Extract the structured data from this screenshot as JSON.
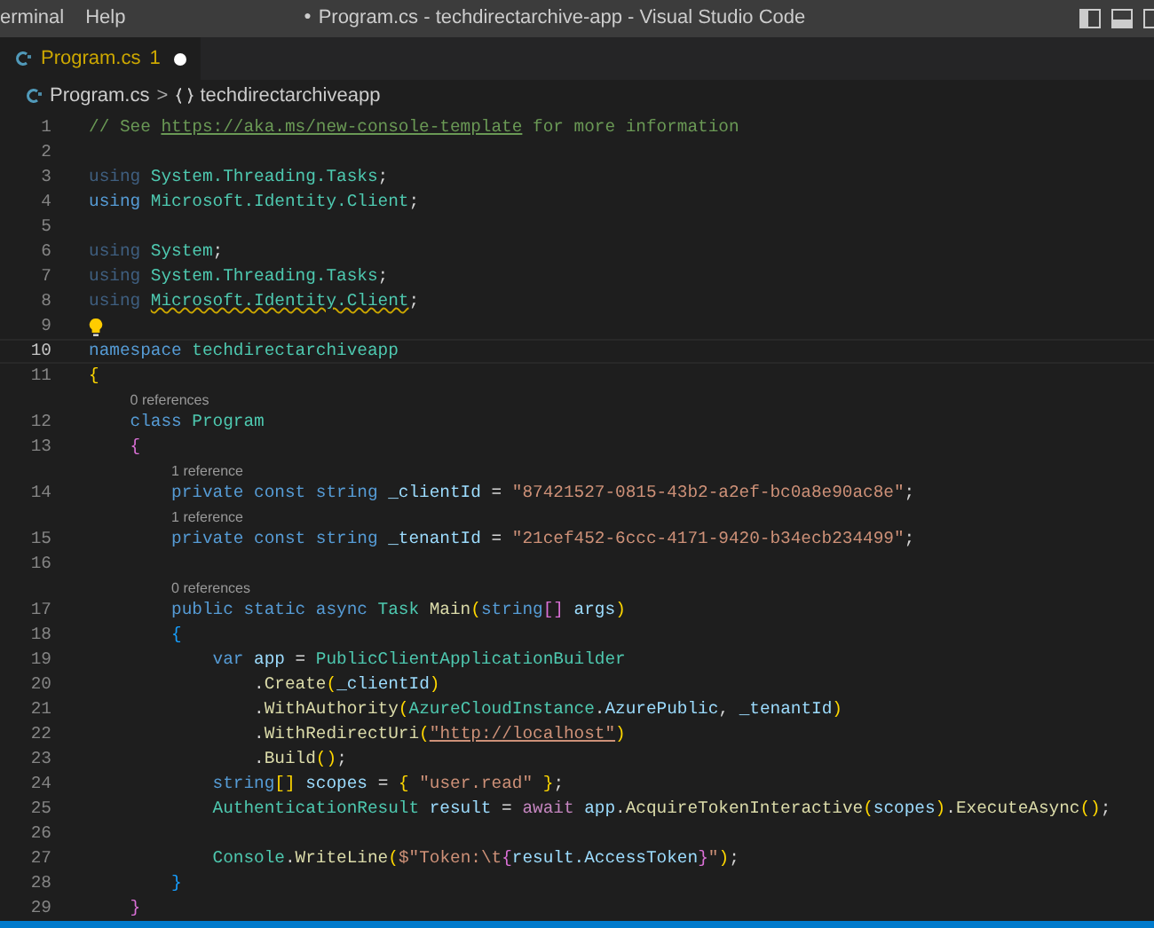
{
  "title_bar": {
    "menus": [
      "erminal",
      "Help"
    ],
    "modified_marker": "●",
    "title": "Program.cs - techdirectarchive-app - Visual Studio Code"
  },
  "tabs": [
    {
      "label": "Program.cs",
      "problems": "1",
      "modified": true,
      "selected": true
    }
  ],
  "breadcrumb": {
    "file": "Program.cs",
    "separator": ">",
    "symbol": "techdirectarchiveapp"
  },
  "lines": [
    {
      "number": "1",
      "tokens": [
        {
          "kind": "comment",
          "text": "// See "
        },
        {
          "kind": "link",
          "text": "https://aka.ms/new-console-template"
        },
        {
          "kind": "comment",
          "text": " for more information"
        }
      ]
    },
    {
      "number": "2"
    },
    {
      "number": "3",
      "tokens": [
        {
          "kind": "unused",
          "text": "using "
        },
        {
          "kind": "type",
          "text": "System.Threading.Tasks"
        },
        {
          "kind": "plain",
          "text": ";"
        }
      ]
    },
    {
      "number": "4",
      "tokens": [
        {
          "kind": "keyword",
          "text": "using "
        },
        {
          "kind": "type",
          "text": "Microsoft.Identity.Client"
        },
        {
          "kind": "plain",
          "text": ";"
        }
      ]
    },
    {
      "number": "5"
    },
    {
      "number": "6",
      "tokens": [
        {
          "kind": "unused",
          "text": "using "
        },
        {
          "kind": "type",
          "text": "System"
        },
        {
          "kind": "plain",
          "text": ";"
        }
      ]
    },
    {
      "number": "7",
      "tokens": [
        {
          "kind": "unused",
          "text": "using "
        },
        {
          "kind": "type",
          "text": "System.Threading.Tasks"
        },
        {
          "kind": "plain",
          "text": ";"
        }
      ]
    },
    {
      "number": "8",
      "tokens": [
        {
          "kind": "unused",
          "text": "using "
        },
        {
          "kind": "warning",
          "text": "Microsoft.Identity.Client"
        },
        {
          "kind": "plain",
          "text": ";"
        }
      ]
    },
    {
      "number": "9",
      "lightbulb": true
    },
    {
      "number": "10",
      "current": true,
      "tokens": [
        {
          "kind": "keyword",
          "text": "namespace "
        },
        {
          "kind": "type",
          "text": "techdirectarchiveapp"
        }
      ]
    },
    {
      "number": "11",
      "tokens": [
        {
          "kind": "bracket1",
          "text": "{"
        }
      ]
    },
    {
      "number": "12",
      "codelens": "0 references",
      "tokens": [
        {
          "kind": "keyword",
          "text": "    class "
        },
        {
          "kind": "type",
          "text": "Program"
        }
      ]
    },
    {
      "number": "13",
      "tokens": [
        {
          "kind": "bracket2",
          "text": "    {"
        }
      ]
    },
    {
      "number": "14",
      "codelens": "1 reference",
      "tokens": [
        {
          "kind": "keyword",
          "text": "        private const string "
        },
        {
          "kind": "variable",
          "text": "_clientId"
        },
        {
          "kind": "plain",
          "text": " = "
        },
        {
          "kind": "string",
          "text": "\"87421527-0815-43b2-a2ef-bc0a8e90ac8e\""
        },
        {
          "kind": "plain",
          "text": ";"
        }
      ]
    },
    {
      "number": "15",
      "codelens": "1 reference",
      "tokens": [
        {
          "kind": "keyword",
          "text": "        private const string "
        },
        {
          "kind": "variable",
          "text": "_tenantId"
        },
        {
          "kind": "plain",
          "text": " = "
        },
        {
          "kind": "string",
          "text": "\"21cef452-6ccc-4171-9420-b34ecb234499\""
        },
        {
          "kind": "plain",
          "text": ";"
        }
      ]
    },
    {
      "number": "16"
    },
    {
      "number": "17",
      "codelens": "0 references",
      "tokens": [
        {
          "kind": "keyword",
          "text": "        public static async "
        },
        {
          "kind": "type",
          "text": "Task "
        },
        {
          "kind": "function",
          "text": "Main"
        },
        {
          "kind": "bracket1",
          "text": "("
        },
        {
          "kind": "keyword",
          "text": "string"
        },
        {
          "kind": "bracket2",
          "text": "[]"
        },
        {
          "kind": "variable",
          "text": " args"
        },
        {
          "kind": "bracket1",
          "text": ")"
        }
      ]
    },
    {
      "number": "18",
      "tokens": [
        {
          "kind": "bracket3",
          "text": "        {"
        }
      ]
    },
    {
      "number": "19",
      "tokens": [
        {
          "kind": "keyword",
          "text": "            var "
        },
        {
          "kind": "variable",
          "text": "app"
        },
        {
          "kind": "plain",
          "text": " = "
        },
        {
          "kind": "type",
          "text": "PublicClientApplicationBuilder"
        }
      ]
    },
    {
      "number": "20",
      "tokens": [
        {
          "kind": "plain",
          "text": "                ."
        },
        {
          "kind": "function",
          "text": "Create"
        },
        {
          "kind": "bracket1",
          "text": "("
        },
        {
          "kind": "variable",
          "text": "_clientId"
        },
        {
          "kind": "bracket1",
          "text": ")"
        }
      ]
    },
    {
      "number": "21",
      "tokens": [
        {
          "kind": "plain",
          "text": "                ."
        },
        {
          "kind": "function",
          "text": "WithAuthority"
        },
        {
          "kind": "bracket1",
          "text": "("
        },
        {
          "kind": "type",
          "text": "AzureCloudInstance"
        },
        {
          "kind": "plain",
          "text": "."
        },
        {
          "kind": "variable",
          "text": "AzurePublic"
        },
        {
          "kind": "plain",
          "text": ", "
        },
        {
          "kind": "variable",
          "text": "_tenantId"
        },
        {
          "kind": "bracket1",
          "text": ")"
        }
      ]
    },
    {
      "number": "22",
      "tokens": [
        {
          "kind": "plain",
          "text": "                ."
        },
        {
          "kind": "function",
          "text": "WithRedirectUri"
        },
        {
          "kind": "bracket1",
          "text": "("
        },
        {
          "kind": "stringlink",
          "text": "\"http://localhost\""
        },
        {
          "kind": "bracket1",
          "text": ")"
        }
      ]
    },
    {
      "number": "23",
      "tokens": [
        {
          "kind": "plain",
          "text": "                ."
        },
        {
          "kind": "function",
          "text": "Build"
        },
        {
          "kind": "bracket1",
          "text": "()"
        },
        {
          "kind": "plain",
          "text": ";"
        }
      ]
    },
    {
      "number": "24",
      "tokens": [
        {
          "kind": "keyword",
          "text": "            string"
        },
        {
          "kind": "bracket1",
          "text": "[]"
        },
        {
          "kind": "variable",
          "text": " scopes"
        },
        {
          "kind": "plain",
          "text": " = "
        },
        {
          "kind": "bracket1",
          "text": "{ "
        },
        {
          "kind": "string",
          "text": "\"user.read\""
        },
        {
          "kind": "bracket1",
          "text": " }"
        },
        {
          "kind": "plain",
          "text": ";"
        }
      ]
    },
    {
      "number": "25",
      "tokens": [
        {
          "kind": "type",
          "text": "            AuthenticationResult"
        },
        {
          "kind": "variable",
          "text": " result"
        },
        {
          "kind": "plain",
          "text": " = "
        },
        {
          "kind": "control",
          "text": "await "
        },
        {
          "kind": "variable",
          "text": "app"
        },
        {
          "kind": "plain",
          "text": "."
        },
        {
          "kind": "function",
          "text": "AcquireTokenInteractive"
        },
        {
          "kind": "bracket1",
          "text": "("
        },
        {
          "kind": "variable",
          "text": "scopes"
        },
        {
          "kind": "bracket1",
          "text": ")"
        },
        {
          "kind": "plain",
          "text": "."
        },
        {
          "kind": "function",
          "text": "ExecuteAsync"
        },
        {
          "kind": "bracket1",
          "text": "()"
        },
        {
          "kind": "plain",
          "text": ";"
        }
      ]
    },
    {
      "number": "26"
    },
    {
      "number": "27",
      "tokens": [
        {
          "kind": "type",
          "text": "            Console"
        },
        {
          "kind": "plain",
          "text": "."
        },
        {
          "kind": "function",
          "text": "WriteLine"
        },
        {
          "kind": "bracket1",
          "text": "("
        },
        {
          "kind": "string",
          "text": "$\"Token:\\t"
        },
        {
          "kind": "bracket2",
          "text": "{"
        },
        {
          "kind": "variable",
          "text": "result.AccessToken"
        },
        {
          "kind": "bracket2",
          "text": "}"
        },
        {
          "kind": "string",
          "text": "\""
        },
        {
          "kind": "bracket1",
          "text": ")"
        },
        {
          "kind": "plain",
          "text": ";"
        }
      ]
    },
    {
      "number": "28",
      "tokens": [
        {
          "kind": "bracket3",
          "text": "        }"
        }
      ]
    },
    {
      "number": "29",
      "tokens": [
        {
          "kind": "bracket2",
          "text": "    }"
        }
      ]
    }
  ]
}
